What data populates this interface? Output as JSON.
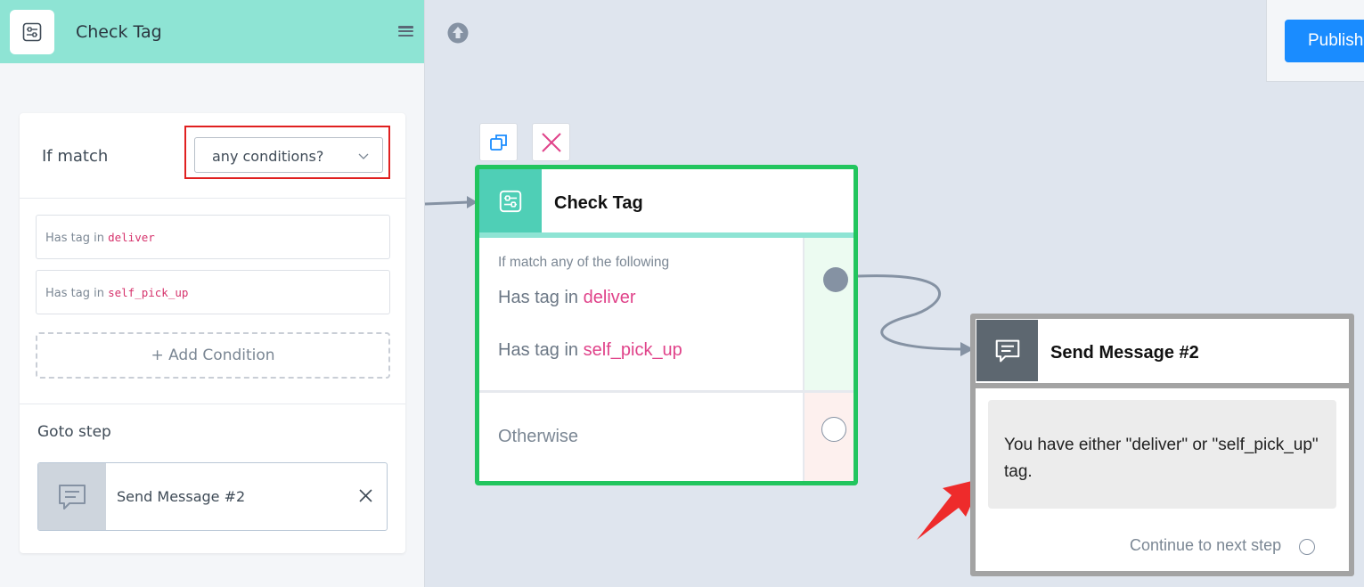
{
  "sidebar": {
    "title": "Check Tag",
    "match_label": "If match",
    "match_value": "any conditions?",
    "conditions": [
      {
        "prefix": "Has tag in",
        "tag": "deliver"
      },
      {
        "prefix": "Has tag in",
        "tag": "self_pick_up"
      }
    ],
    "add_condition": "+ Add Condition",
    "goto_label": "Goto step",
    "goto_target": "Send Message #2"
  },
  "toolbar": {
    "publish_label": "Publish"
  },
  "check_node": {
    "title": "Check Tag",
    "subtitle": "If match any of the following",
    "conditions": [
      {
        "prefix": "Has tag in",
        "tag": "deliver"
      },
      {
        "prefix": "Has tag in",
        "tag": "self_pick_up"
      }
    ],
    "otherwise": "Otherwise"
  },
  "send_node": {
    "title": "Send Message #2",
    "message": "You have either \"deliver\" or \"self_pick_up\" tag.",
    "continue_label": "Continue to next step"
  },
  "icons": [
    "filter-sliders-icon",
    "menu-icon",
    "chevron-down-icon",
    "message-icon",
    "close-icon",
    "upload-icon",
    "copy-icon",
    "delete-x-icon"
  ],
  "colors": {
    "header_teal": "#8ee4d4",
    "node_selected": "#22c55e",
    "tag_pink": "#e0438a",
    "publish_blue": "#1a8cff",
    "highlight_red": "#e02020"
  }
}
